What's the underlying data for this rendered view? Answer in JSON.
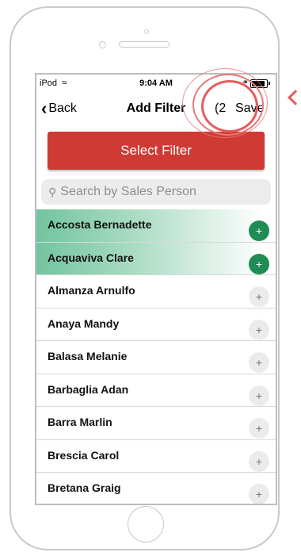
{
  "status_bar": {
    "carrier": "iPod",
    "time": "9:04 AM"
  },
  "nav": {
    "back_label": "Back",
    "title": "Add Filter",
    "count": "(2",
    "save_label": "Save"
  },
  "select_filter_label": "Select Filter",
  "search": {
    "placeholder": "Search by Sales Person"
  },
  "list": [
    {
      "name": "Accosta Bernadette",
      "selected": true
    },
    {
      "name": "Acquaviva Clare",
      "selected": true
    },
    {
      "name": "Almanza Arnulfo",
      "selected": false
    },
    {
      "name": "Anaya Mandy",
      "selected": false
    },
    {
      "name": "Balasa Melanie",
      "selected": false
    },
    {
      "name": "Barbaglia Adan",
      "selected": false
    },
    {
      "name": "Barra Marlin",
      "selected": false
    },
    {
      "name": "Brescia Carol",
      "selected": false
    },
    {
      "name": "Bretana Graig",
      "selected": false
    }
  ],
  "colors": {
    "accent_red": "#cf3a34",
    "selected_green": "#1e8c55",
    "highlight_ring": "#e45c5c"
  },
  "icons": {
    "back": "chevron-left-icon",
    "search": "search-icon",
    "add": "plus-icon",
    "wifi": "wifi-icon",
    "battery": "battery-icon"
  }
}
